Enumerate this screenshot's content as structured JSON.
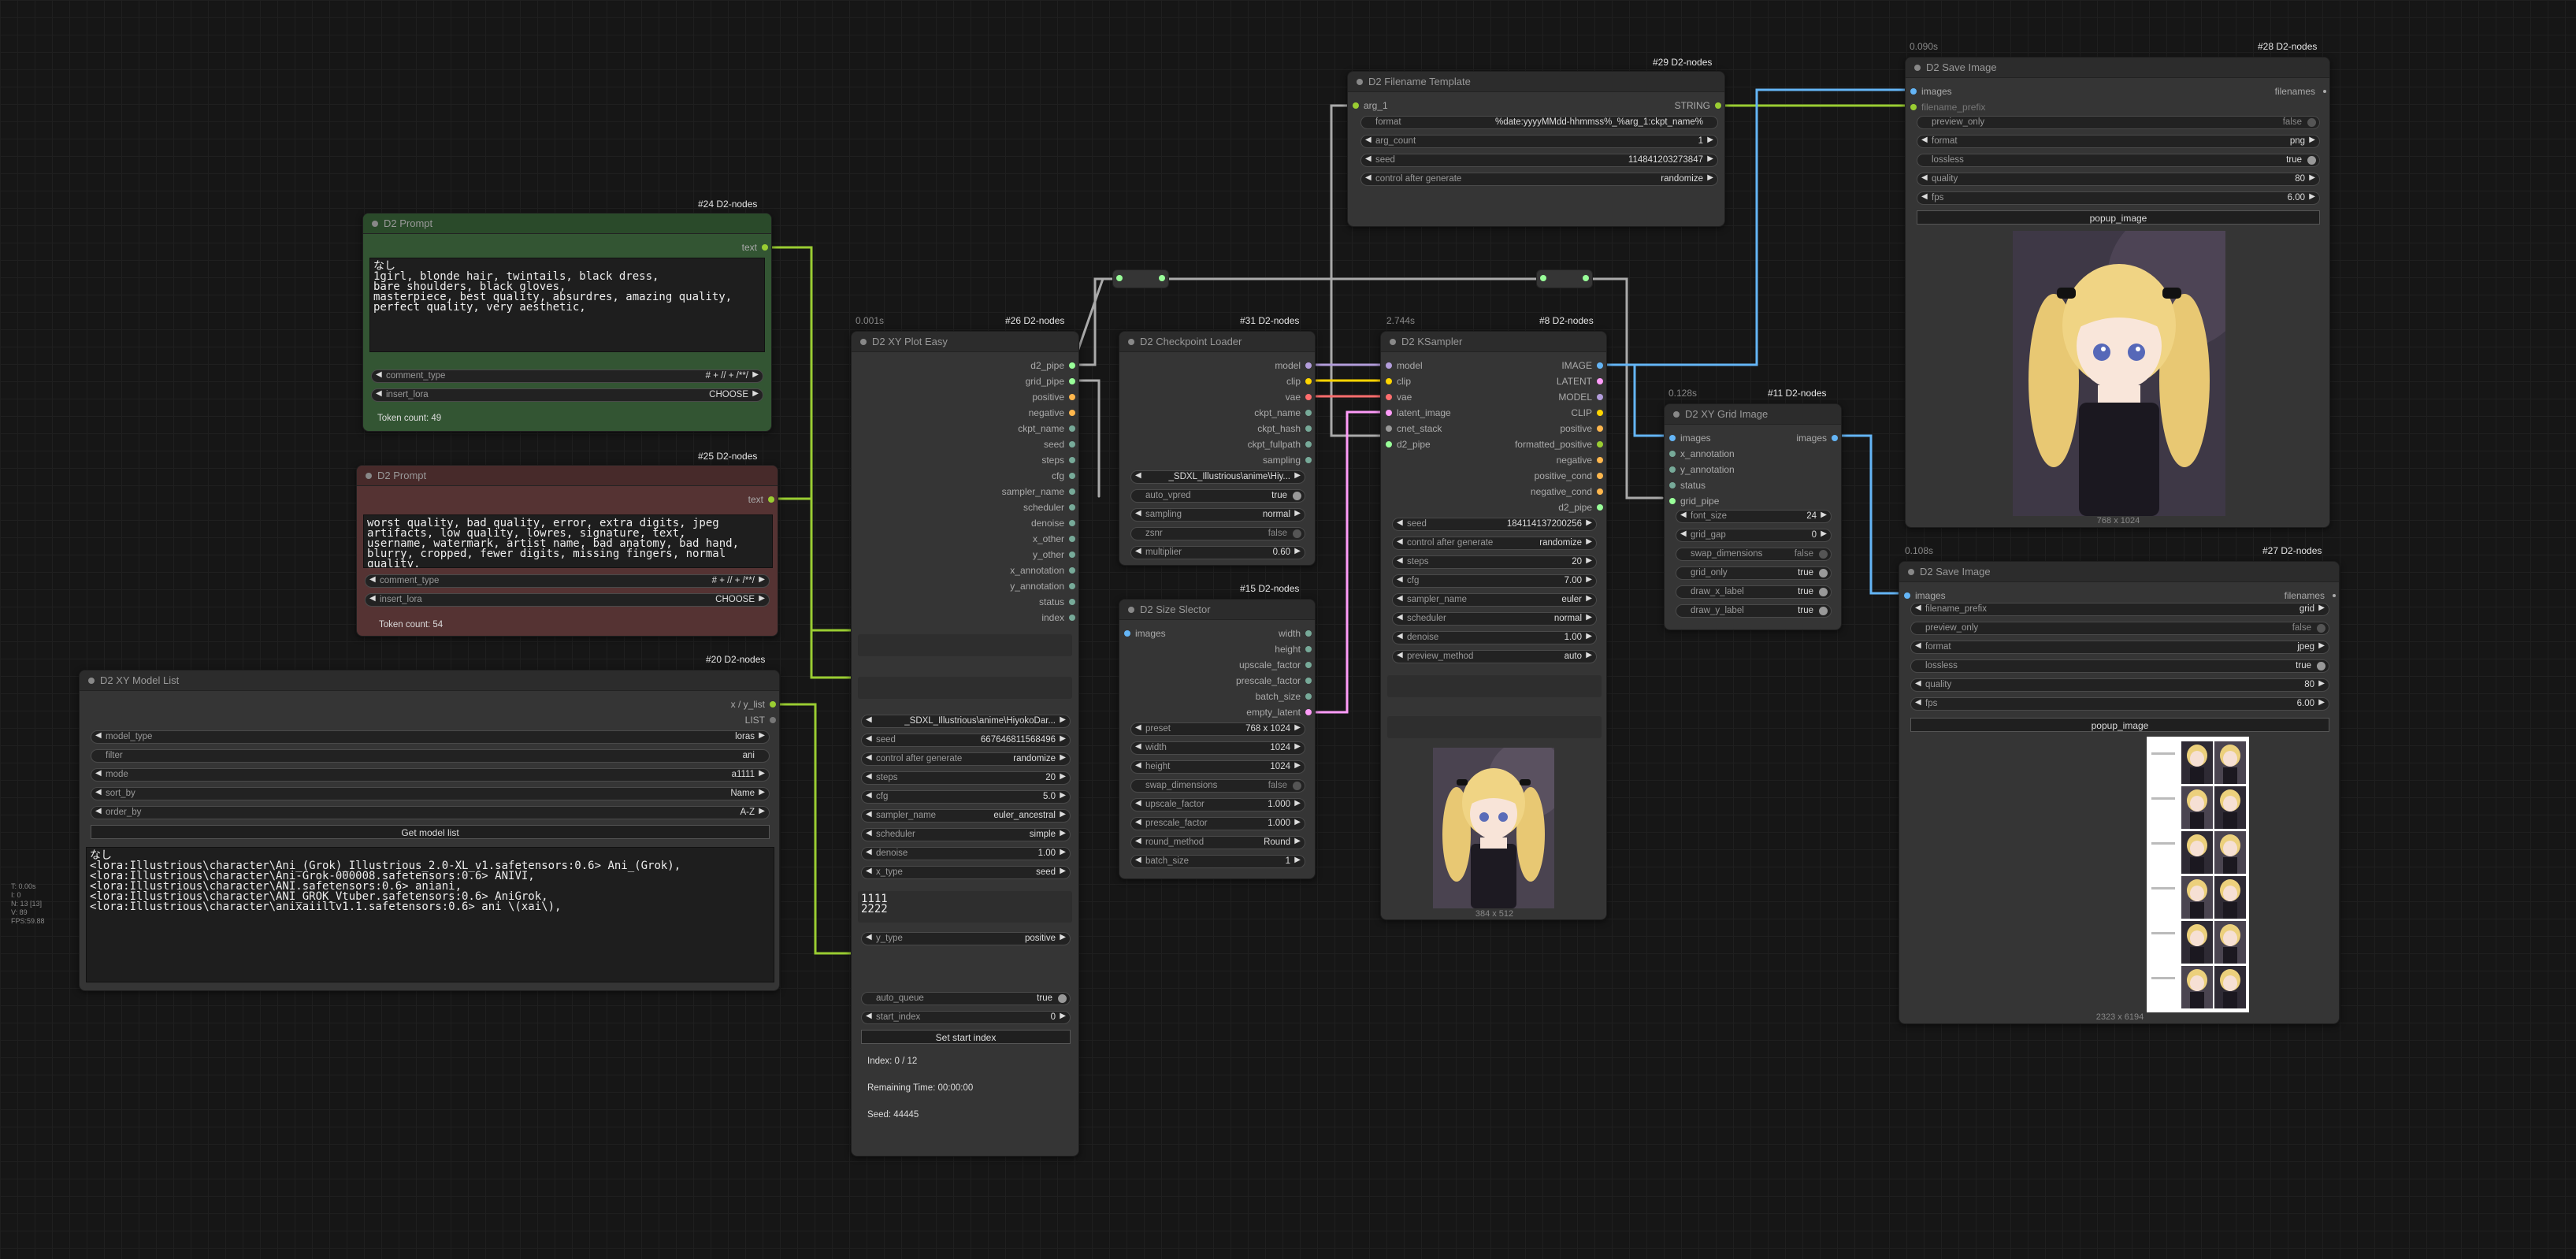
{
  "canvas_stats": [
    "T: 0.00s",
    "I: 0",
    "N: 13 [13]",
    "V: 89",
    "FPS:59.88"
  ],
  "colors": {
    "image": "#64b5f6",
    "clip": "#ffd500",
    "model": "#b39ddb",
    "vae": "#ff6e6e",
    "latent": "#ff9cf9",
    "string": "#9acd32",
    "pipe": "#9f9"
  },
  "prompt_pos": {
    "badge": "#24 D2-nodes",
    "title": "D2 Prompt",
    "out": "text",
    "text": "なし\n1girl, blonde hair, twintails, black dress,\nbare shoulders, black gloves,\nmasterpiece, best quality, absurdres, amazing quality,\nperfect quality, very aesthetic,",
    "comment_type_label": "comment_type",
    "comment_type_value": "# + // + /**/",
    "insert_lora_label": "insert_lora",
    "insert_lora_value": "CHOOSE",
    "token_count": "Token count: 49"
  },
  "prompt_neg": {
    "badge": "#25 D2-nodes",
    "title": "D2 Prompt",
    "out": "text",
    "text": "worst quality, bad quality, error, extra digits, jpeg\nartifacts, low quality, lowres, signature, text,\nusername, watermark, artist name, bad anatomy, bad hand,\nblurry, cropped, fewer digits, missing fingers, normal\nquality,",
    "comment_type_label": "comment_type",
    "comment_type_value": "# + // + /**/",
    "insert_lora_label": "insert_lora",
    "insert_lora_value": "CHOOSE",
    "token_count": "Token count: 54"
  },
  "model_list": {
    "badge": "#20 D2-nodes",
    "title": "D2 XY Model List",
    "out1": "x / y_list",
    "out2": "LIST",
    "widgets": [
      {
        "label": "model_type",
        "value": "loras"
      },
      {
        "label": "filter",
        "value": "ani"
      },
      {
        "label": "mode",
        "value": "a1111"
      },
      {
        "label": "sort_by",
        "value": "Name"
      },
      {
        "label": "order_by",
        "value": "A-Z"
      }
    ],
    "button": "Get model list",
    "text": "なし\n<lora:Illustrious\\character\\Ani_(Grok)_Illustrious_2.0-XL_v1.safetensors:0.6> Ani_(Grok),\n<lora:Illustrious\\character\\Ani-Grok-000008.safetensors:0.6> ANIVI,\n<lora:Illustrious\\character\\ANI.safetensors:0.6> aniani,\n<lora:Illustrious\\character\\ANI_GROK_Vtuber.safetensors:0.6> AniGrok,\n<lora:Illustrious\\character\\anixaiillv1.1.safetensors:0.6> ani \\(xai\\),"
  },
  "xy_plot": {
    "time": "0.001s",
    "badge": "#26 D2-nodes",
    "title": "D2 XY Plot Easy",
    "outputs": [
      "d2_pipe",
      "grid_pipe",
      "positive",
      "negative",
      "ckpt_name",
      "seed",
      "steps",
      "cfg",
      "sampler_name",
      "scheduler",
      "denoise",
      "x_other",
      "y_other",
      "x_annotation",
      "y_annotation",
      "status",
      "index"
    ],
    "widgets": [
      {
        "label": "",
        "value": "_SDXL_Illustrious\\anime\\HiyokoDar..."
      },
      {
        "label": "seed",
        "value": "667646811568496"
      },
      {
        "label": "control after generate",
        "value": "randomize"
      },
      {
        "label": "steps",
        "value": "20"
      },
      {
        "label": "cfg",
        "value": "5.0"
      },
      {
        "label": "sampler_name",
        "value": "euler_ancestral"
      },
      {
        "label": "scheduler",
        "value": "simple"
      },
      {
        "label": "denoise",
        "value": "1.00"
      },
      {
        "label": "x_type",
        "value": "seed"
      }
    ],
    "x_list": "1111\n2222",
    "y_type_label": "y_type",
    "y_type_value": "positive",
    "auto_queue_label": "auto_queue",
    "auto_queue_value": "true",
    "start_index_label": "start_index",
    "start_index_value": "0",
    "button": "Set start index",
    "index_text": "Index: 0 / 12",
    "remaining_text": "Remaining Time: 00:00:00",
    "seed_text": "Seed: 44445"
  },
  "checkpoint": {
    "badge": "#31 D2-nodes",
    "title": "D2 Checkpoint Loader",
    "outputs": [
      "model",
      "clip",
      "vae",
      "ckpt_name",
      "ckpt_hash",
      "ckpt_fullpath",
      "sampling"
    ],
    "widgets": [
      {
        "label": "",
        "value": "_SDXL_Illustrious\\anime\\Hiy..."
      },
      {
        "label": "auto_vpred",
        "value": "true",
        "toggle": true,
        "on": true
      },
      {
        "label": "sampling",
        "value": "normal"
      },
      {
        "label": "zsnr",
        "value": "false",
        "toggle": true,
        "on": false
      },
      {
        "label": "multiplier",
        "value": "0.60"
      }
    ]
  },
  "size_selector": {
    "badge": "#15 D2-nodes",
    "title": "D2 Size Slector",
    "input": "images",
    "outputs": [
      "width",
      "height",
      "upscale_factor",
      "prescale_factor",
      "batch_size",
      "empty_latent"
    ],
    "widgets": [
      {
        "label": "preset",
        "value": "768 x 1024"
      },
      {
        "label": "width",
        "value": "1024"
      },
      {
        "label": "height",
        "value": "1024"
      },
      {
        "label": "swap_dimensions",
        "value": "false",
        "toggle": true,
        "on": false
      },
      {
        "label": "upscale_factor",
        "value": "1.000"
      },
      {
        "label": "prescale_factor",
        "value": "1.000"
      },
      {
        "label": "round_method",
        "value": "Round"
      },
      {
        "label": "batch_size",
        "value": "1"
      }
    ]
  },
  "ksampler": {
    "time": "2.744s",
    "badge": "#8 D2-nodes",
    "title": "D2 KSampler",
    "inputs": [
      "model",
      "clip",
      "vae",
      "latent_image",
      "cnet_stack",
      "d2_pipe"
    ],
    "outputs": [
      "IMAGE",
      "LATENT",
      "MODEL",
      "CLIP",
      "positive",
      "formatted_positive",
      "negative",
      "positive_cond",
      "negative_cond",
      "d2_pipe"
    ],
    "widgets": [
      {
        "label": "seed",
        "value": "184114137200256"
      },
      {
        "label": "control after generate",
        "value": "randomize"
      },
      {
        "label": "steps",
        "value": "20"
      },
      {
        "label": "cfg",
        "value": "7.00"
      },
      {
        "label": "sampler_name",
        "value": "euler"
      },
      {
        "label": "scheduler",
        "value": "normal"
      },
      {
        "label": "denoise",
        "value": "1.00"
      },
      {
        "label": "preview_method",
        "value": "auto"
      }
    ],
    "image_dims": "384 x 512"
  },
  "filename_template": {
    "badge": "#29 D2-nodes",
    "title": "D2 Filename Template",
    "input": "arg_1",
    "output": "STRING",
    "widgets": [
      {
        "label": "format",
        "value": "%date:yyyyMMdd-hhmmss%_%arg_1:ckpt_name%"
      },
      {
        "label": "arg_count",
        "value": "1"
      },
      {
        "label": "seed",
        "value": "114841203273847"
      },
      {
        "label": "control after generate",
        "value": "randomize"
      }
    ]
  },
  "grid_image": {
    "time": "0.128s",
    "badge": "#11 D2-nodes",
    "title": "D2 XY Grid Image",
    "inputs": [
      "images",
      "x_annotation",
      "y_annotation",
      "status",
      "grid_pipe"
    ],
    "output": "images",
    "widgets": [
      {
        "label": "font_size",
        "value": "24"
      },
      {
        "label": "grid_gap",
        "value": "0"
      },
      {
        "label": "swap_dimensions",
        "value": "false",
        "toggle": true,
        "on": false
      },
      {
        "label": "grid_only",
        "value": "true",
        "toggle": true,
        "on": true
      },
      {
        "label": "draw_x_label",
        "value": "true",
        "toggle": true,
        "on": true
      },
      {
        "label": "draw_y_label",
        "value": "true",
        "toggle": true,
        "on": true
      }
    ]
  },
  "save_top": {
    "time": "0.090s",
    "badge": "#28 D2-nodes",
    "title": "D2 Save Image",
    "inputs": [
      "images",
      "filename_prefix"
    ],
    "output": "filenames",
    "widgets": [
      {
        "label": "preview_only",
        "value": "false",
        "toggle": true,
        "on": false
      },
      {
        "label": "format",
        "value": "png"
      },
      {
        "label": "lossless",
        "value": "true",
        "toggle": true,
        "on": true
      },
      {
        "label": "quality",
        "value": "80"
      },
      {
        "label": "fps",
        "value": "6.00"
      }
    ],
    "button": "popup_image",
    "image_dims": "768 x 1024"
  },
  "save_bottom": {
    "time": "0.108s",
    "badge": "#27 D2-nodes",
    "title": "D2 Save Image",
    "input": "images",
    "output": "filenames",
    "widgets": [
      {
        "label": "filename_prefix",
        "value": "grid"
      },
      {
        "label": "preview_only",
        "value": "false",
        "toggle": true,
        "on": false
      },
      {
        "label": "format",
        "value": "jpeg"
      },
      {
        "label": "lossless",
        "value": "true",
        "toggle": true,
        "on": true
      },
      {
        "label": "quality",
        "value": "80"
      },
      {
        "label": "fps",
        "value": "6.00"
      }
    ],
    "button": "popup_image",
    "image_dims": "2323 x 6194"
  }
}
